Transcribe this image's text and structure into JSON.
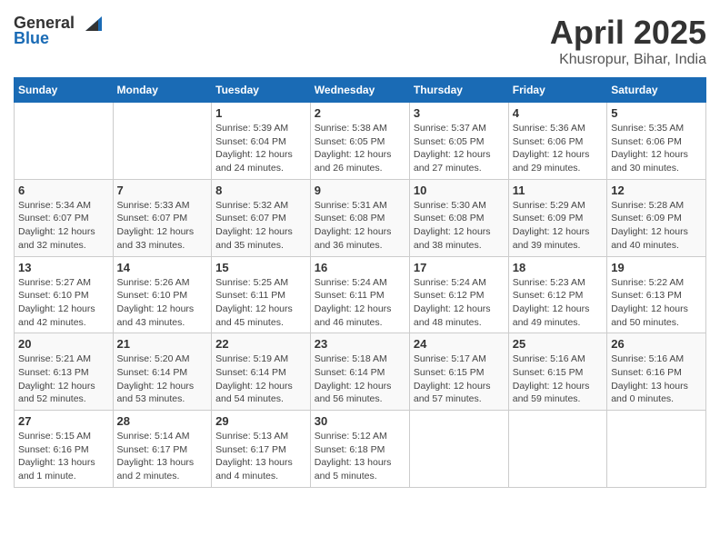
{
  "header": {
    "logo_general": "General",
    "logo_blue": "Blue",
    "title": "April 2025",
    "location": "Khusropur, Bihar, India"
  },
  "days_of_week": [
    "Sunday",
    "Monday",
    "Tuesday",
    "Wednesday",
    "Thursday",
    "Friday",
    "Saturday"
  ],
  "weeks": [
    [
      {
        "day": "",
        "info": ""
      },
      {
        "day": "",
        "info": ""
      },
      {
        "day": "1",
        "info": "Sunrise: 5:39 AM\nSunset: 6:04 PM\nDaylight: 12 hours and 24 minutes."
      },
      {
        "day": "2",
        "info": "Sunrise: 5:38 AM\nSunset: 6:05 PM\nDaylight: 12 hours and 26 minutes."
      },
      {
        "day": "3",
        "info": "Sunrise: 5:37 AM\nSunset: 6:05 PM\nDaylight: 12 hours and 27 minutes."
      },
      {
        "day": "4",
        "info": "Sunrise: 5:36 AM\nSunset: 6:06 PM\nDaylight: 12 hours and 29 minutes."
      },
      {
        "day": "5",
        "info": "Sunrise: 5:35 AM\nSunset: 6:06 PM\nDaylight: 12 hours and 30 minutes."
      }
    ],
    [
      {
        "day": "6",
        "info": "Sunrise: 5:34 AM\nSunset: 6:07 PM\nDaylight: 12 hours and 32 minutes."
      },
      {
        "day": "7",
        "info": "Sunrise: 5:33 AM\nSunset: 6:07 PM\nDaylight: 12 hours and 33 minutes."
      },
      {
        "day": "8",
        "info": "Sunrise: 5:32 AM\nSunset: 6:07 PM\nDaylight: 12 hours and 35 minutes."
      },
      {
        "day": "9",
        "info": "Sunrise: 5:31 AM\nSunset: 6:08 PM\nDaylight: 12 hours and 36 minutes."
      },
      {
        "day": "10",
        "info": "Sunrise: 5:30 AM\nSunset: 6:08 PM\nDaylight: 12 hours and 38 minutes."
      },
      {
        "day": "11",
        "info": "Sunrise: 5:29 AM\nSunset: 6:09 PM\nDaylight: 12 hours and 39 minutes."
      },
      {
        "day": "12",
        "info": "Sunrise: 5:28 AM\nSunset: 6:09 PM\nDaylight: 12 hours and 40 minutes."
      }
    ],
    [
      {
        "day": "13",
        "info": "Sunrise: 5:27 AM\nSunset: 6:10 PM\nDaylight: 12 hours and 42 minutes."
      },
      {
        "day": "14",
        "info": "Sunrise: 5:26 AM\nSunset: 6:10 PM\nDaylight: 12 hours and 43 minutes."
      },
      {
        "day": "15",
        "info": "Sunrise: 5:25 AM\nSunset: 6:11 PM\nDaylight: 12 hours and 45 minutes."
      },
      {
        "day": "16",
        "info": "Sunrise: 5:24 AM\nSunset: 6:11 PM\nDaylight: 12 hours and 46 minutes."
      },
      {
        "day": "17",
        "info": "Sunrise: 5:24 AM\nSunset: 6:12 PM\nDaylight: 12 hours and 48 minutes."
      },
      {
        "day": "18",
        "info": "Sunrise: 5:23 AM\nSunset: 6:12 PM\nDaylight: 12 hours and 49 minutes."
      },
      {
        "day": "19",
        "info": "Sunrise: 5:22 AM\nSunset: 6:13 PM\nDaylight: 12 hours and 50 minutes."
      }
    ],
    [
      {
        "day": "20",
        "info": "Sunrise: 5:21 AM\nSunset: 6:13 PM\nDaylight: 12 hours and 52 minutes."
      },
      {
        "day": "21",
        "info": "Sunrise: 5:20 AM\nSunset: 6:14 PM\nDaylight: 12 hours and 53 minutes."
      },
      {
        "day": "22",
        "info": "Sunrise: 5:19 AM\nSunset: 6:14 PM\nDaylight: 12 hours and 54 minutes."
      },
      {
        "day": "23",
        "info": "Sunrise: 5:18 AM\nSunset: 6:14 PM\nDaylight: 12 hours and 56 minutes."
      },
      {
        "day": "24",
        "info": "Sunrise: 5:17 AM\nSunset: 6:15 PM\nDaylight: 12 hours and 57 minutes."
      },
      {
        "day": "25",
        "info": "Sunrise: 5:16 AM\nSunset: 6:15 PM\nDaylight: 12 hours and 59 minutes."
      },
      {
        "day": "26",
        "info": "Sunrise: 5:16 AM\nSunset: 6:16 PM\nDaylight: 13 hours and 0 minutes."
      }
    ],
    [
      {
        "day": "27",
        "info": "Sunrise: 5:15 AM\nSunset: 6:16 PM\nDaylight: 13 hours and 1 minute."
      },
      {
        "day": "28",
        "info": "Sunrise: 5:14 AM\nSunset: 6:17 PM\nDaylight: 13 hours and 2 minutes."
      },
      {
        "day": "29",
        "info": "Sunrise: 5:13 AM\nSunset: 6:17 PM\nDaylight: 13 hours and 4 minutes."
      },
      {
        "day": "30",
        "info": "Sunrise: 5:12 AM\nSunset: 6:18 PM\nDaylight: 13 hours and 5 minutes."
      },
      {
        "day": "",
        "info": ""
      },
      {
        "day": "",
        "info": ""
      },
      {
        "day": "",
        "info": ""
      }
    ]
  ]
}
